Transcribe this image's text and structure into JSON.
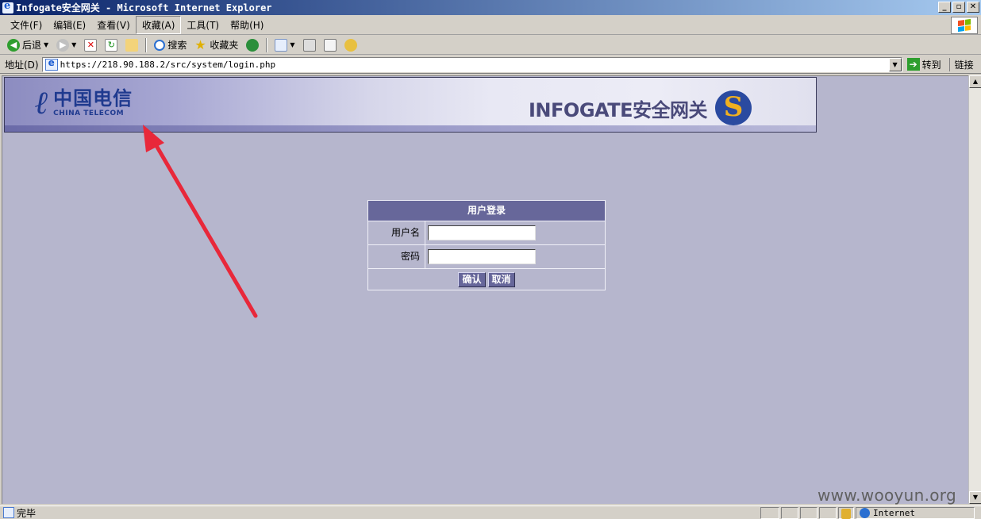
{
  "window": {
    "title": "Infogate安全网关 - Microsoft Internet Explorer",
    "min_label": "_",
    "max_label": "▫",
    "close_label": "✕"
  },
  "menu": [
    {
      "label": "文件(F)"
    },
    {
      "label": "编辑(E)"
    },
    {
      "label": "查看(V)"
    },
    {
      "label": "收藏(A)"
    },
    {
      "label": "工具(T)"
    },
    {
      "label": "帮助(H)"
    }
  ],
  "toolbar": {
    "back_label": "后退",
    "search_label": "搜索",
    "favorites_label": "收藏夹"
  },
  "address": {
    "label": "地址(D)",
    "url": "https://218.90.188.2/src/system/login.php",
    "go_label": "转到",
    "links_label": "链接"
  },
  "banner": {
    "ct_cn": "中国电信",
    "ct_en": "CHINA TELECOM",
    "product_name": "INFOGATE安全网关",
    "s_logo": "S"
  },
  "login": {
    "title": "用户登录",
    "username_label": "用户名",
    "password_label": "密码",
    "username_value": "",
    "password_value": "",
    "confirm_label": "确认",
    "cancel_label": "取消"
  },
  "status": {
    "text": "完毕",
    "zone": "Internet"
  },
  "watermark": "www.wooyun.org",
  "colors": {
    "page_bg": "#b6b6cd",
    "panel_header": "#67679a",
    "arrow": "#e8283a"
  }
}
